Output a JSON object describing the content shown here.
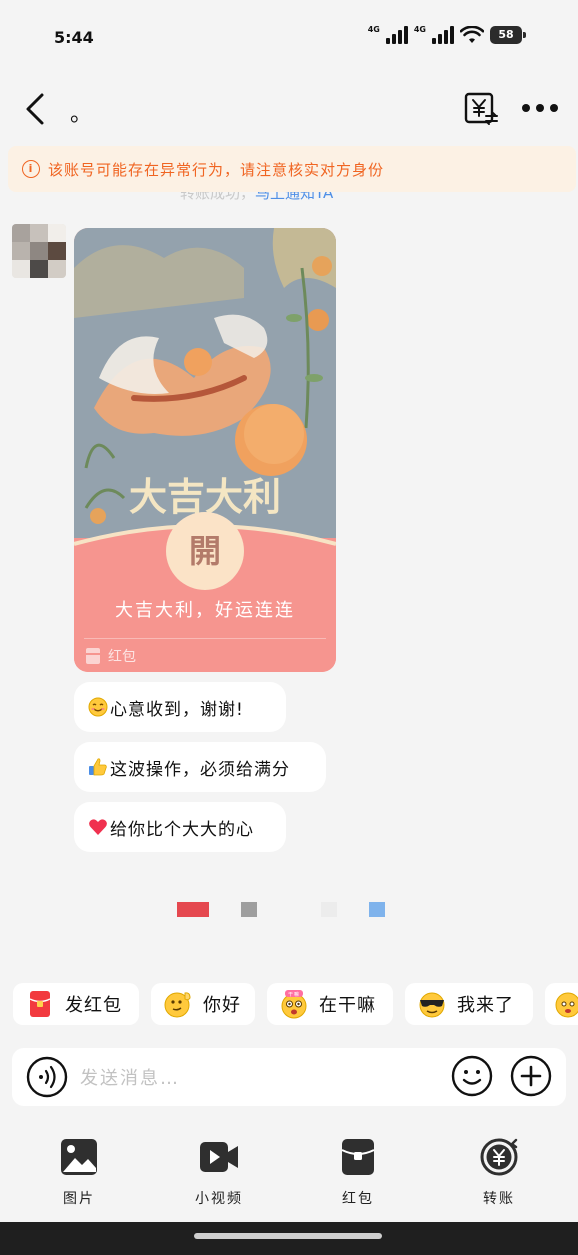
{
  "status_bar": {
    "time": "5:44",
    "network_1": "4G",
    "network_2": "4G",
    "battery": "58"
  },
  "nav": {
    "title": "。",
    "back_icon": "chevron-left-icon",
    "pay_icon": "yuan-transfer-icon",
    "more_icon": "more-dots-icon"
  },
  "warning": {
    "icon": "info-icon",
    "text": "该账号可能存在异常行为，请注意核实对方身份"
  },
  "behind_notice": {
    "text": "转账成功，",
    "link": "马上通知TA"
  },
  "red_packet": {
    "art_text": "大吉大利",
    "open_label": "開",
    "wish": "大吉大利，好运连连",
    "footer_label": "红包"
  },
  "messages": [
    {
      "emoji": "smile-emoji",
      "text": "心意收到，谢谢!"
    },
    {
      "emoji": "thumbs-up-emoji",
      "text": "这波操作，必须给满分"
    },
    {
      "emoji": "heart-emoji",
      "text": "给你比个大大的心"
    }
  ],
  "color_swatches": [
    "#e5484f",
    "#9e9e9e",
    "#ececec",
    "#7fb3ec"
  ],
  "quick_replies": [
    {
      "icon": "red-packet-icon",
      "label": "发红包"
    },
    {
      "icon": "wave-emoji",
      "label": "你好"
    },
    {
      "icon": "what-are-you-doing-emoji",
      "label": "在干嘛",
      "sticker": "干嘛"
    },
    {
      "icon": "sunglasses-emoji",
      "label": "我来了"
    },
    {
      "icon": "emoji-partial",
      "label": ""
    }
  ],
  "input": {
    "placeholder": "发送消息…",
    "value": ""
  },
  "toolbar": [
    {
      "icon": "image-icon",
      "label": "图片"
    },
    {
      "icon": "video-icon",
      "label": "小视频"
    },
    {
      "icon": "red-packet-icon",
      "label": "红包"
    },
    {
      "icon": "transfer-icon",
      "label": "转账"
    }
  ],
  "colors": {
    "accent_red": "#f6958f",
    "warning": "#f06522",
    "link": "#4f8fe6"
  }
}
